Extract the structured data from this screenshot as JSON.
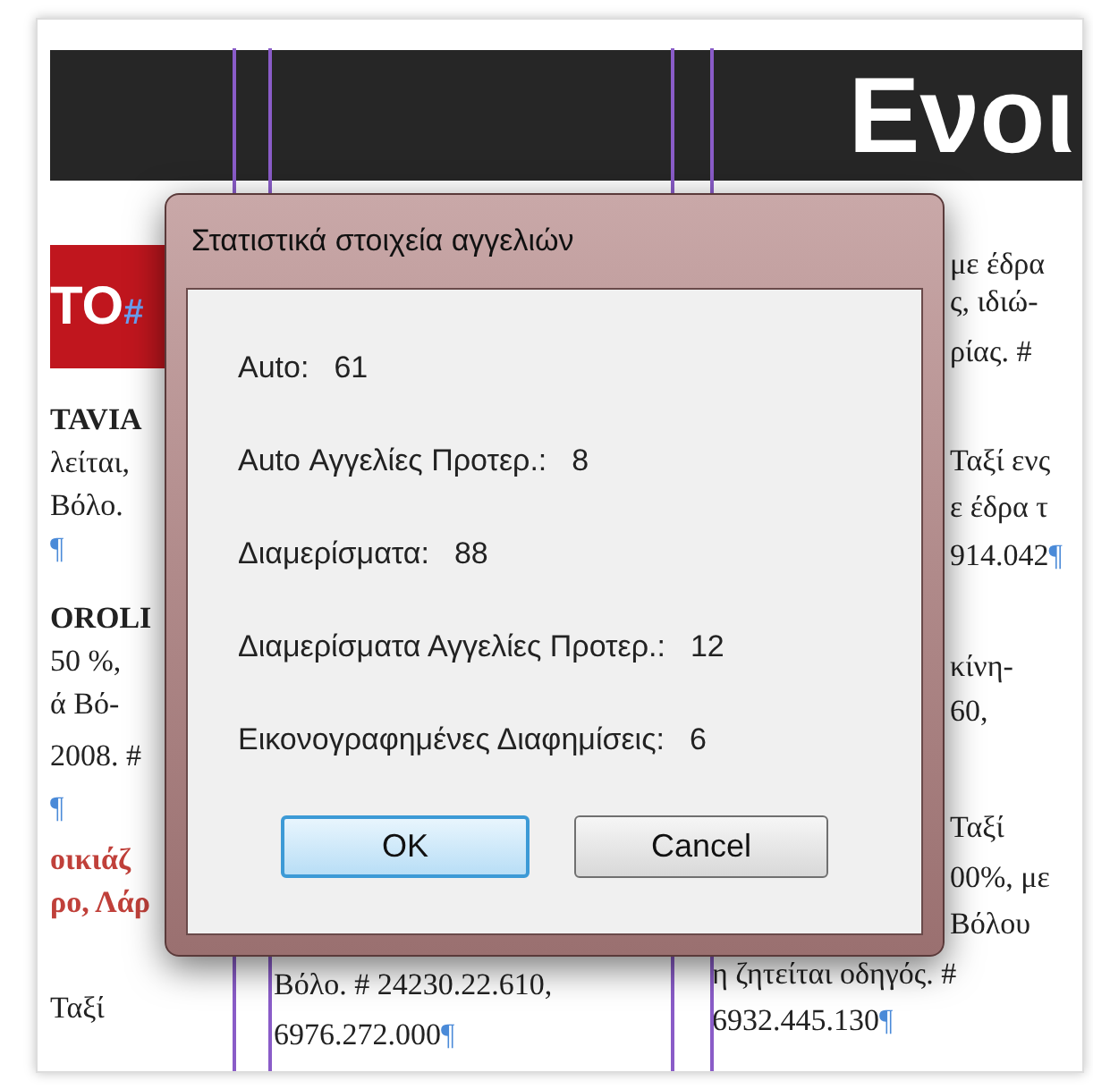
{
  "document": {
    "heading": "Ενοι",
    "banner": {
      "text": "ΤΟ",
      "mark": "#"
    },
    "left_column": [
      {
        "text": "TAVIA",
        "kind": "bold"
      },
      {
        "text": "λείται,",
        "kind": "plain"
      },
      {
        "text": "Βόλο.",
        "kind": "plain"
      },
      {
        "text": "¶",
        "kind": "mark"
      },
      {
        "text": "OROLI",
        "kind": "bold"
      },
      {
        "text": "50 %,",
        "kind": "plain"
      },
      {
        "text": "ά Βό-",
        "kind": "plain"
      },
      {
        "text": "2008. #",
        "kind": "plain"
      },
      {
        "text": "¶",
        "kind": "mark"
      },
      {
        "text": "οικιάζ",
        "kind": "red"
      },
      {
        "text": "ρο, Λάρ",
        "kind": "red"
      },
      {
        "text": "Ταξί",
        "kind": "plain"
      }
    ],
    "middle_column": [
      {
        "text": "Βόλο. # 24230.22.610,",
        "kind": "plain"
      },
      {
        "text": "6976.272.000",
        "kind": "plain",
        "end": "¶"
      }
    ],
    "right_column": [
      {
        "text": "με έδρα",
        "kind": "plain"
      },
      {
        "text": "ς, ιδιώ-",
        "kind": "plain"
      },
      {
        "text": "ρίας. #",
        "kind": "plain"
      },
      {
        "text": "Ταξί ενς",
        "kind": "plain"
      },
      {
        "text": "ε έδρα τ",
        "kind": "plain"
      },
      {
        "text": "914.042",
        "kind": "plain",
        "end": "¶"
      },
      {
        "text": "κίνη-",
        "kind": "plain"
      },
      {
        "text": "60,",
        "kind": "plain"
      },
      {
        "text": "Ταξί",
        "kind": "plain"
      },
      {
        "text": "00%, με",
        "kind": "plain"
      },
      {
        "text": "Βόλου",
        "kind": "plain"
      },
      {
        "text": "η ζητείται οδηγός. #",
        "kind": "plain"
      },
      {
        "text": "6932.445.130",
        "kind": "plain",
        "end": "¶"
      }
    ]
  },
  "dialog": {
    "title": "Στατιστικά στοιχεία αγγελιών",
    "stats": [
      {
        "label": "Auto:",
        "value": "61"
      },
      {
        "label": "Auto Αγγελίες Προτερ.:",
        "value": "8"
      },
      {
        "label": "Διαμερίσματα:",
        "value": "88"
      },
      {
        "label": "Διαμερίσματα Αγγελίες Προτερ.:",
        "value": "12"
      },
      {
        "label": "Εικονογραφημένες Διαφημίσεις:",
        "value": "6"
      }
    ],
    "buttons": [
      {
        "label": "OK",
        "default": true
      },
      {
        "label": "Cancel",
        "default": false
      }
    ]
  }
}
